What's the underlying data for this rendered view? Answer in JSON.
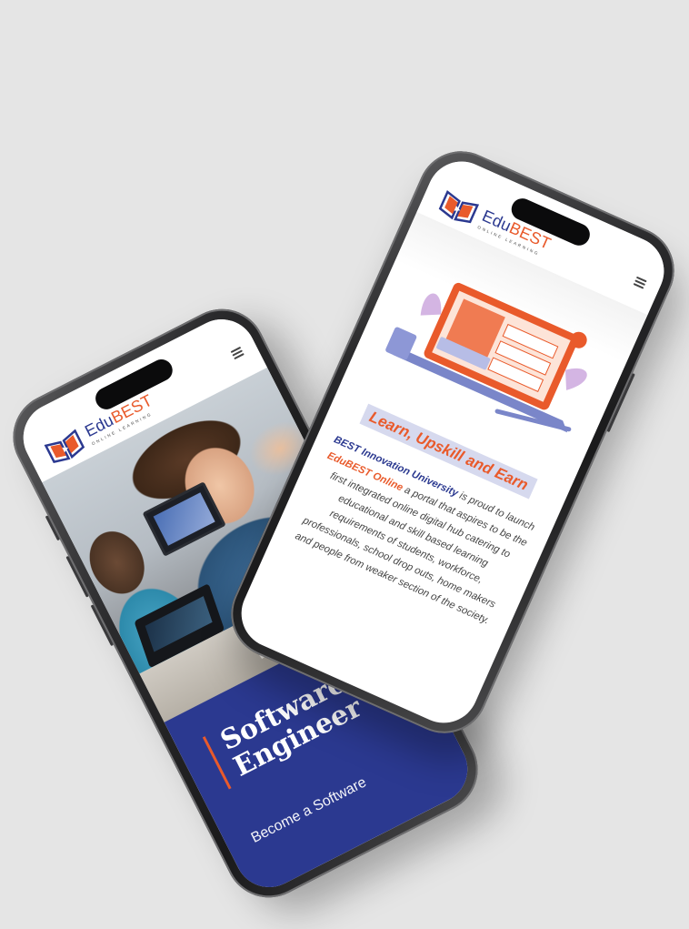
{
  "left_phone": {
    "logo": {
      "edu": "Edu",
      "best": "BEST",
      "tagline": "ONLINE LEARNING"
    },
    "menu_icon": "hamburger-menu-icon",
    "course": {
      "title_line1": "Software",
      "title_line2": "Engineer",
      "subtitle": "Become a Software"
    }
  },
  "right_phone": {
    "logo": {
      "edu": "Edu",
      "best": "BEST",
      "tagline": "ONLINE LEARNING"
    },
    "menu_icon": "hamburger-menu-icon",
    "heading": "Learn, Upskill and Earn",
    "intro": {
      "university": "BEST Innovation University",
      "part1": " is proud to launch ",
      "product": "EduBEST Online",
      "part2": " a portal that aspires to be the first integrated online digital hub catering to educational and skill based learning requirements of students, workforce, professionals, school drop outs, home makers and people from weaker section of the society."
    }
  },
  "colors": {
    "brand_blue": "#2b3990",
    "brand_orange": "#e95a2b",
    "background": "#e5e5e5"
  }
}
